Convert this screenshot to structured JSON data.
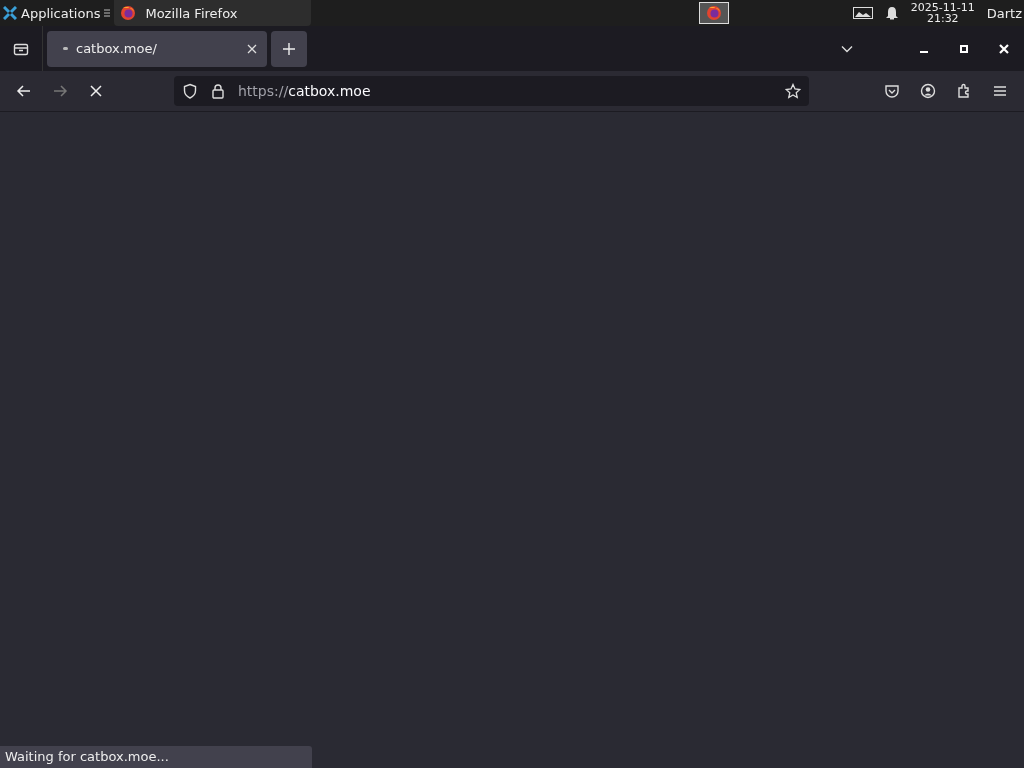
{
  "panel": {
    "menu_label": "Applications",
    "task": {
      "title": "Mozilla Firefox",
      "selected": true
    },
    "date": "2025-11-11",
    "time": "21:32",
    "user": "Dartz"
  },
  "tabs": [
    {
      "title": "catbox.moe/",
      "selected": true
    }
  ],
  "address_bar": {
    "scheme": "https://",
    "host": "catbox.moe"
  },
  "status": "Waiting for catbox.moe..."
}
